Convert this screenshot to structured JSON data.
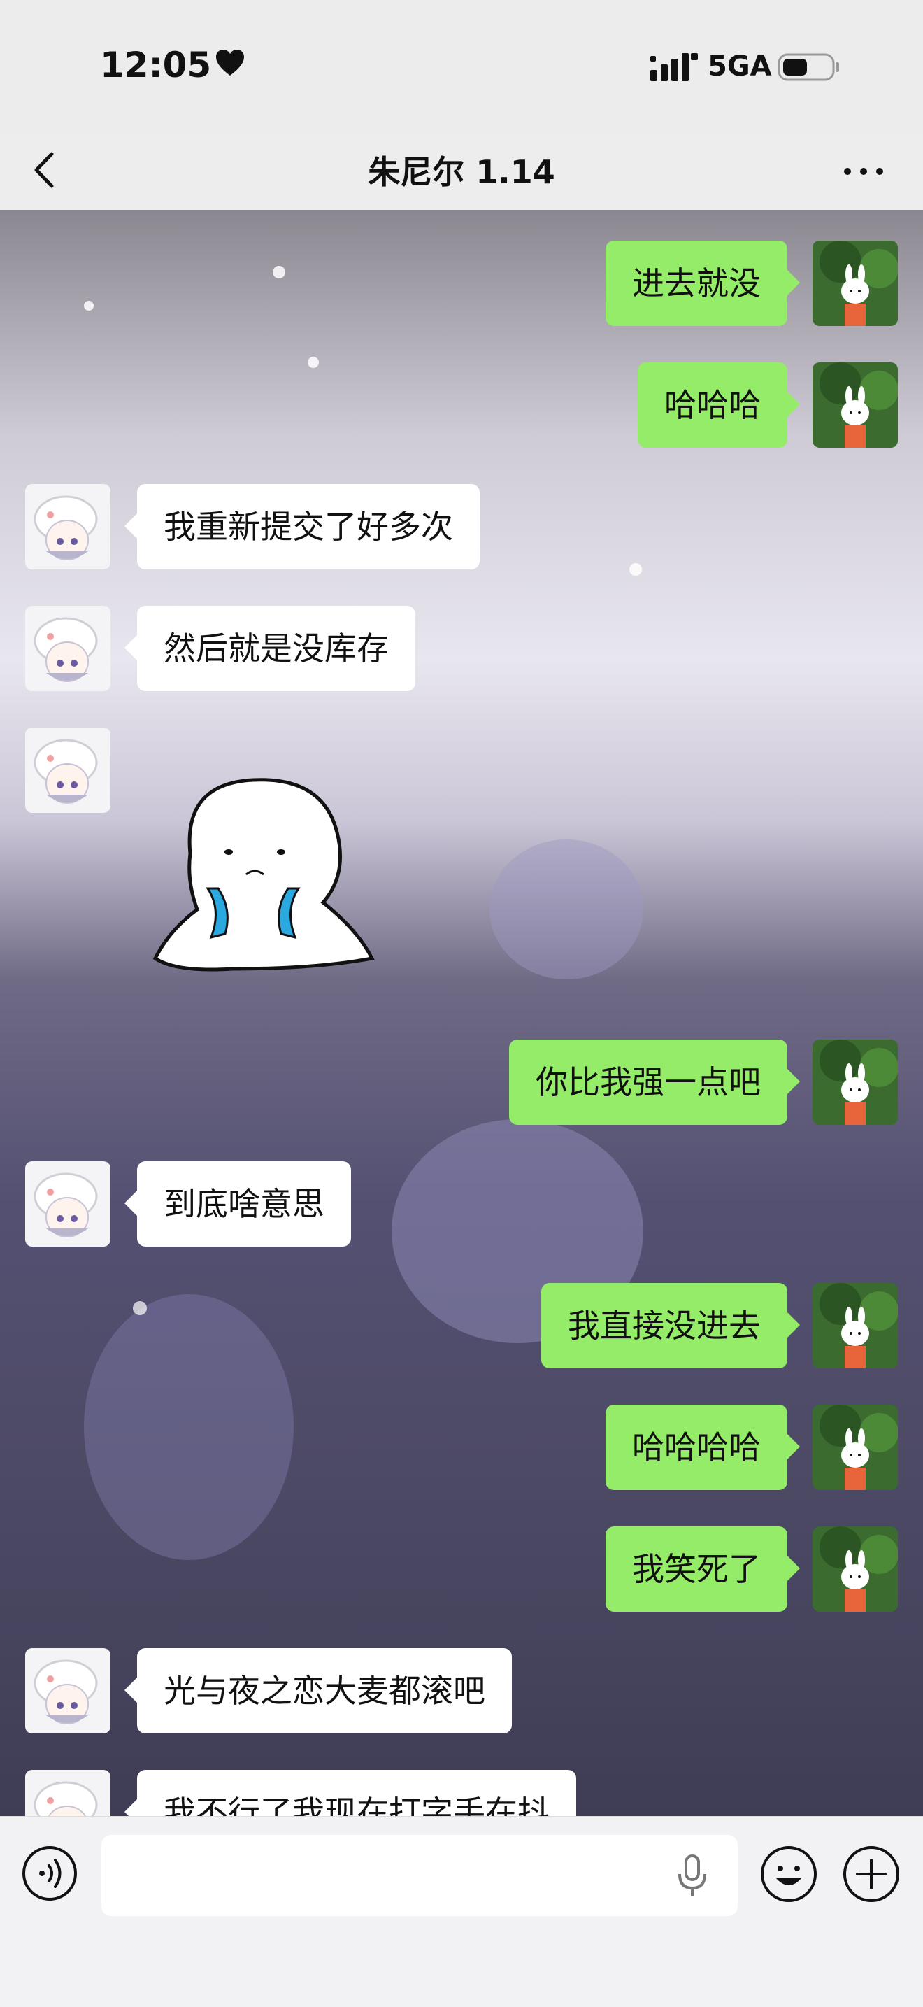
{
  "status_bar": {
    "time": "12:05",
    "network": "5GA",
    "heart_icon": "heart-icon",
    "signal_icon": "signal-icon",
    "battery_icon": "battery-icon"
  },
  "header": {
    "title": "朱尼尔 1.14",
    "back_icon": "chevron-left-icon",
    "more_icon": "more-dots-icon"
  },
  "messages": [
    {
      "sender": "me",
      "text": "进去就没"
    },
    {
      "sender": "me",
      "text": "哈哈哈"
    },
    {
      "sender": "other",
      "text": "我重新提交了好多次"
    },
    {
      "sender": "other",
      "text": "然后就是没库存"
    },
    {
      "sender": "other",
      "type": "sticker",
      "sticker_icon": "crying-ghost-sticker"
    },
    {
      "sender": "me",
      "text": "你比我强一点吧"
    },
    {
      "sender": "other",
      "text": "到底啥意思"
    },
    {
      "sender": "me",
      "text": "我直接没进去"
    },
    {
      "sender": "me",
      "text": "哈哈哈哈"
    },
    {
      "sender": "me",
      "text": "我笑死了"
    },
    {
      "sender": "other",
      "text": "光与夜之恋大麦都滚吧"
    },
    {
      "sender": "other",
      "text": "我不行了我现在打字手在抖"
    }
  ],
  "input_bar": {
    "placeholder": "",
    "voice_icon": "voice-wave-icon",
    "mic_icon": "microphone-icon",
    "emoji_icon": "smiley-icon",
    "plus_icon": "plus-circle-icon"
  },
  "colors": {
    "my_bubble": "#95ec69",
    "their_bubble": "#ffffff",
    "bar_bg": "#ededed"
  }
}
